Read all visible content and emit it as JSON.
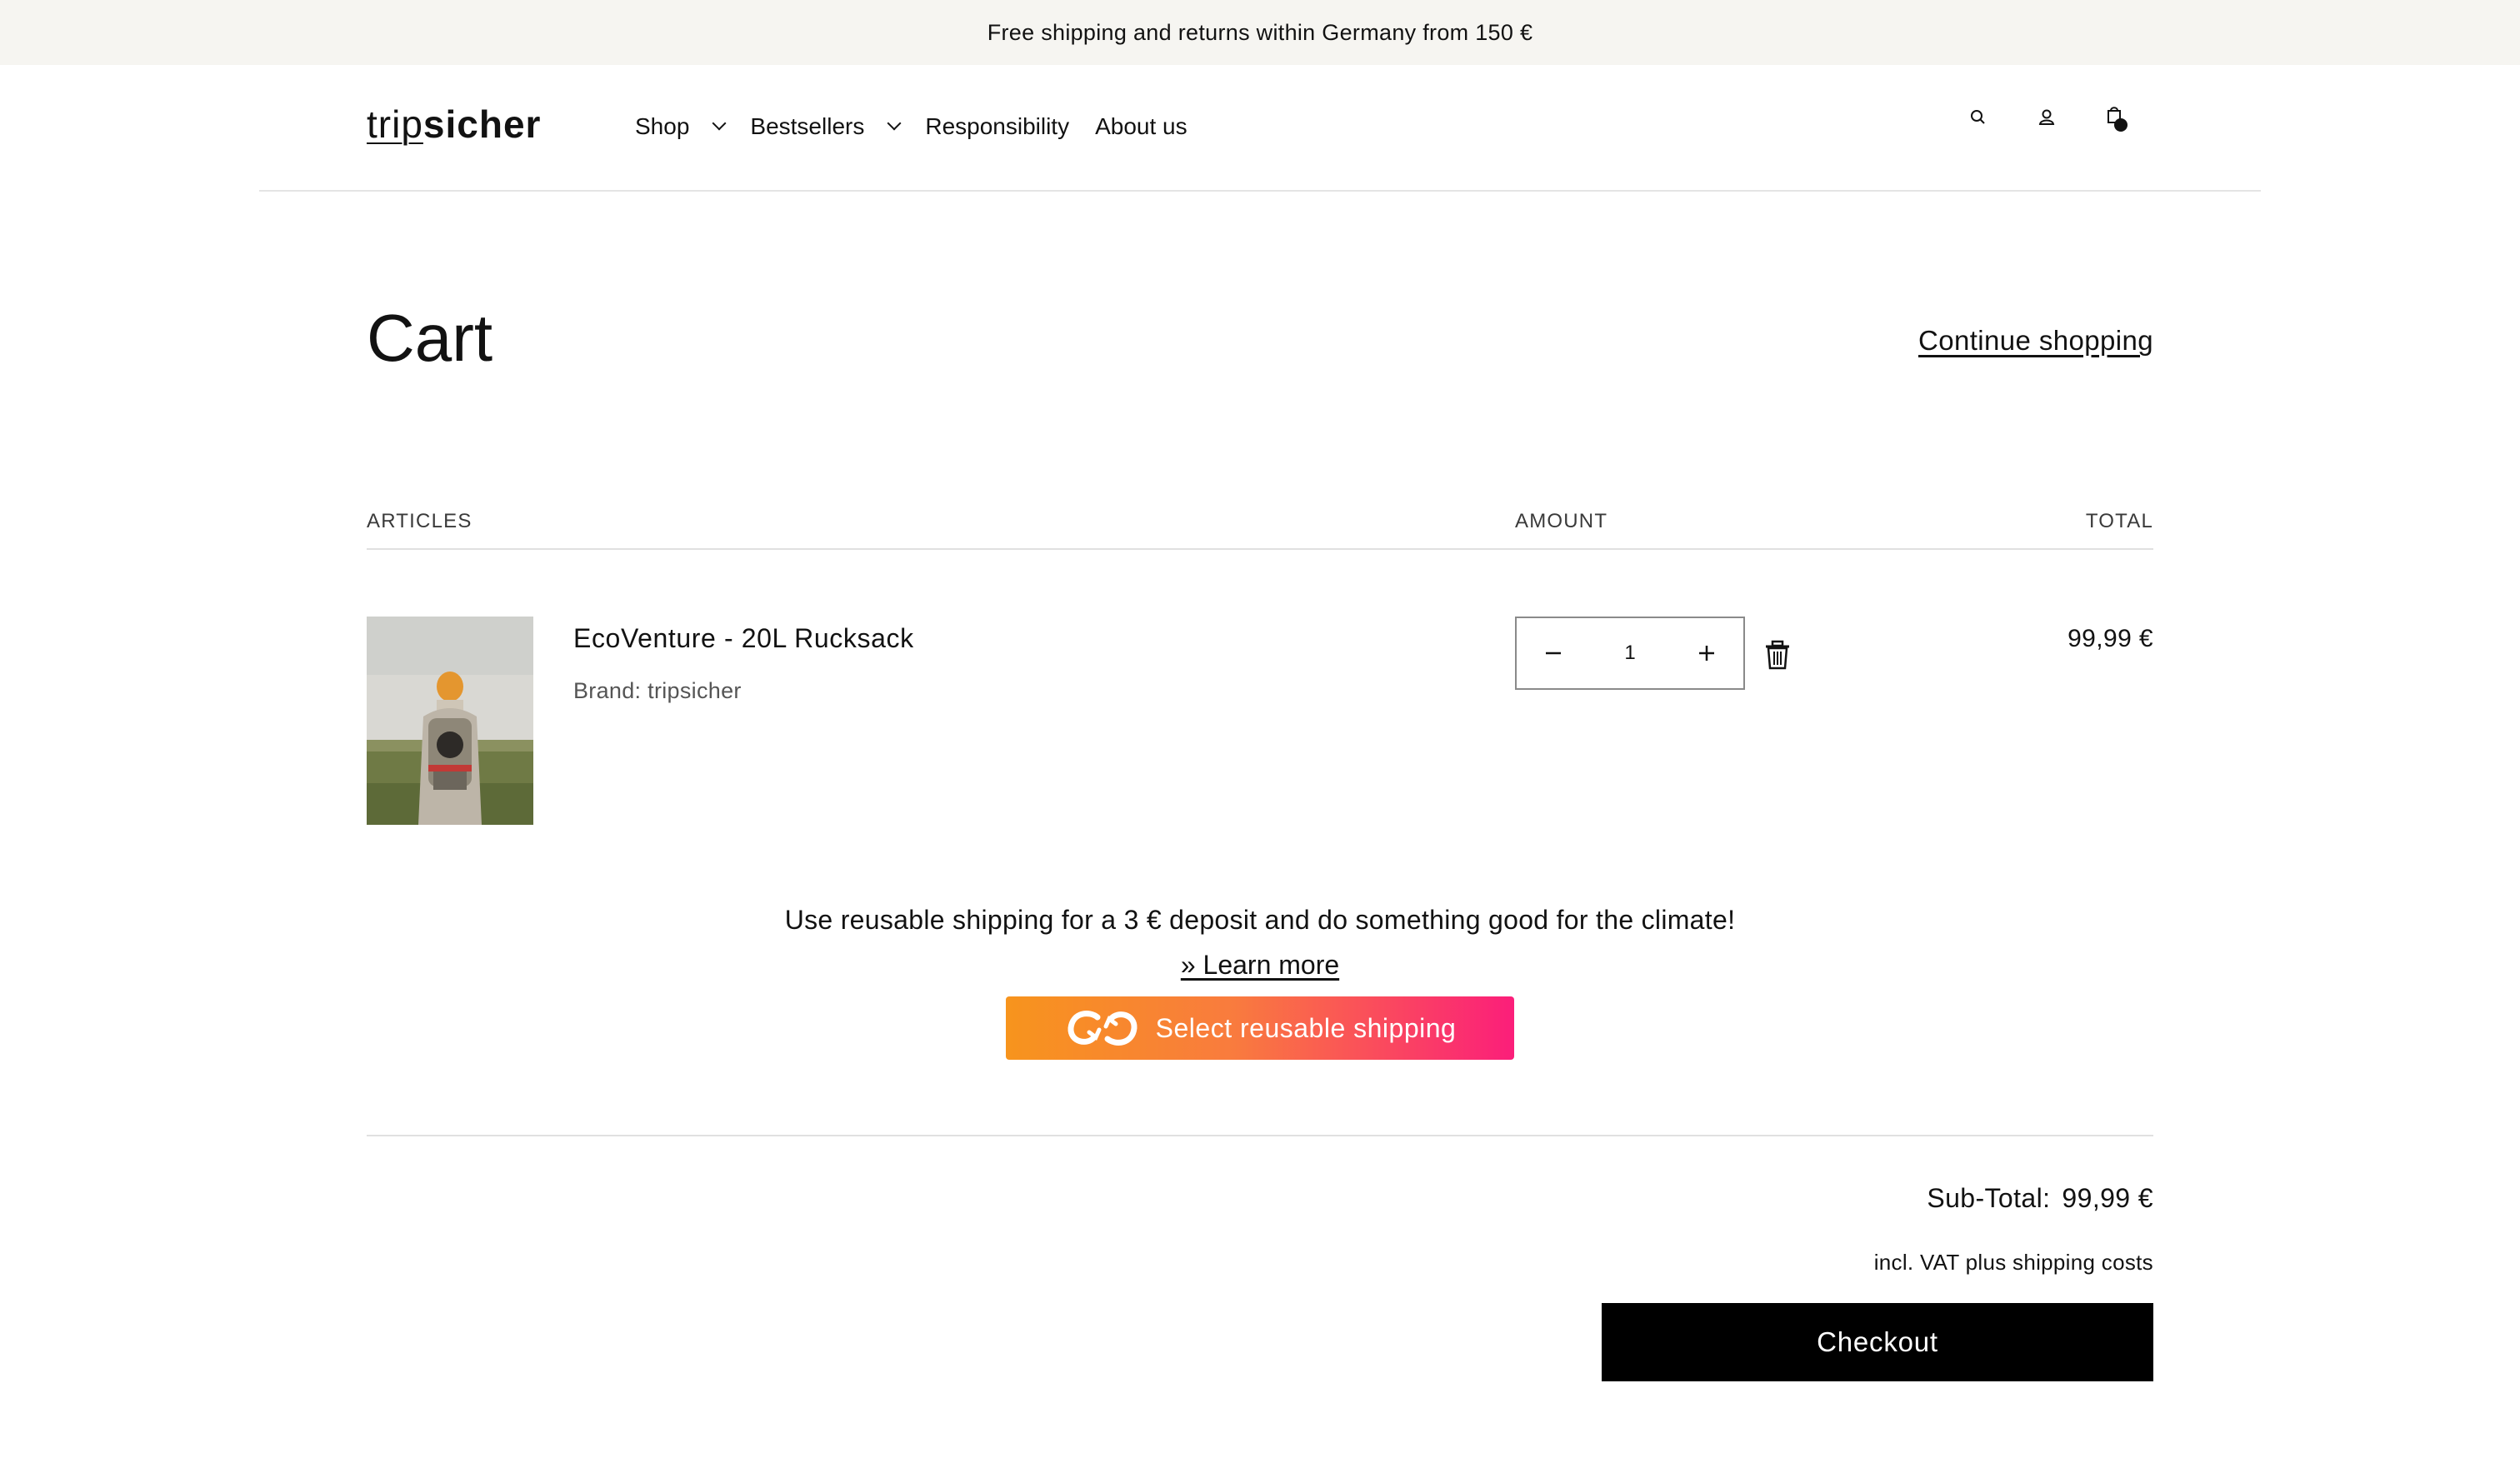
{
  "announcement": "Free shipping and returns within Germany from 150 €",
  "header": {
    "logo_part1": "trip",
    "logo_part2": "sicher",
    "nav": [
      {
        "label": "Shop",
        "dropdown": true
      },
      {
        "label": "Bestsellers",
        "dropdown": true
      },
      {
        "label": "Responsibility",
        "dropdown": false
      },
      {
        "label": "About us",
        "dropdown": false
      }
    ],
    "icons": [
      "search-icon",
      "account-icon",
      "cart-icon"
    ]
  },
  "cart": {
    "title": "Cart",
    "continue_label": "Continue shopping",
    "columns": {
      "articles": "ARTICLES",
      "amount": "AMOUNT",
      "total": "TOTAL"
    },
    "items": [
      {
        "name": "EcoVenture - 20L Rucksack",
        "brand": "Brand: tripsicher",
        "quantity": "1",
        "total": "99,99 €"
      }
    ]
  },
  "reusable": {
    "text": "Use reusable shipping for a 3 € deposit and do something good for the climate!",
    "learn_more": "» Learn more",
    "button_label": "Select reusable shipping",
    "gradient_start": "#f7941d",
    "gradient_end": "#fb1e7a"
  },
  "summary": {
    "subtotal_label": "Sub-Total:",
    "subtotal_value": "99,99 €",
    "vat_note": "incl. VAT plus shipping costs",
    "checkout_label": "Checkout"
  }
}
